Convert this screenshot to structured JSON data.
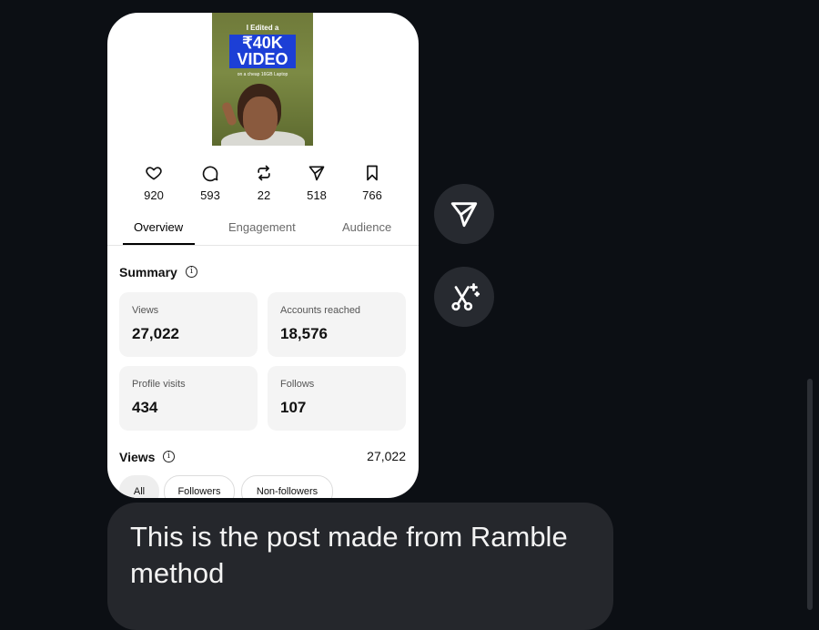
{
  "post": {
    "thumbnail": {
      "line1": "I Edited a",
      "headline_line1": "₹40K",
      "headline_line2": "VIDEO",
      "line3": "on a cheap 16GB Laptop"
    },
    "stats": [
      {
        "icon": "heart-icon",
        "value": "920"
      },
      {
        "icon": "comment-icon",
        "value": "593"
      },
      {
        "icon": "repost-icon",
        "value": "22"
      },
      {
        "icon": "share-icon",
        "value": "518"
      },
      {
        "icon": "bookmark-icon",
        "value": "766"
      }
    ],
    "tabs": [
      "Overview",
      "Engagement",
      "Audience"
    ],
    "active_tab": "Overview"
  },
  "summary": {
    "title": "Summary",
    "tiles": [
      {
        "label": "Views",
        "value": "27,022"
      },
      {
        "label": "Accounts reached",
        "value": "18,576"
      },
      {
        "label": "Profile visits",
        "value": "434"
      },
      {
        "label": "Follows",
        "value": "107"
      }
    ]
  },
  "views_section": {
    "title": "Views",
    "total": "27,022",
    "filters": [
      "All",
      "Followers",
      "Non-followers"
    ],
    "active_filter": "All"
  },
  "side_actions": {
    "share_icon": "share-icon",
    "edit_icon": "magic-scissors-icon"
  },
  "message": {
    "text": "This is the post made from Ramble method"
  },
  "colors": {
    "background": "#0c0f14",
    "bubble": "#25272c",
    "thumbnail_headline": "#1c3fd6"
  }
}
